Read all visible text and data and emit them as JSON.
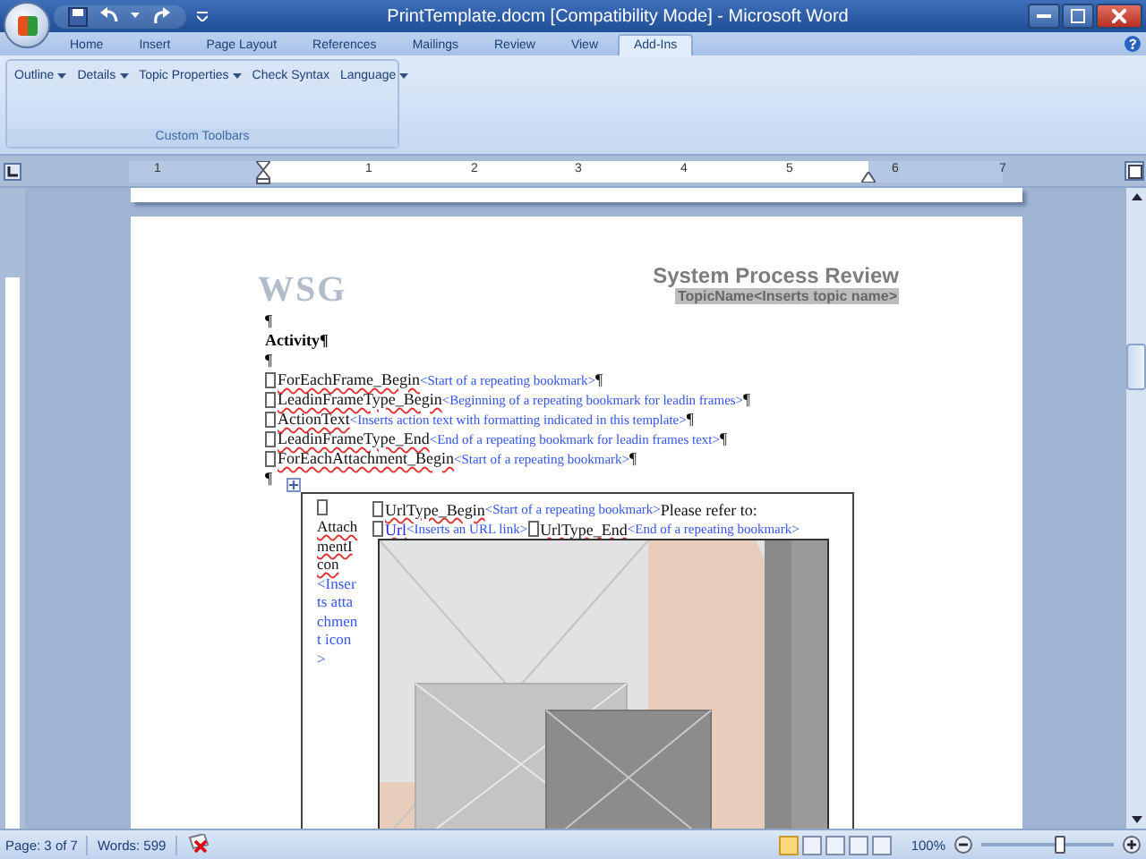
{
  "window": {
    "title": "PrintTemplate.docm [Compatibility Mode] - Microsoft Word"
  },
  "tabs": [
    {
      "label": "Home",
      "selected": false
    },
    {
      "label": "Insert",
      "selected": false
    },
    {
      "label": "Page Layout",
      "selected": false
    },
    {
      "label": "References",
      "selected": false
    },
    {
      "label": "Mailings",
      "selected": false
    },
    {
      "label": "Review",
      "selected": false
    },
    {
      "label": "View",
      "selected": false
    },
    {
      "label": "Add-Ins",
      "selected": true
    }
  ],
  "ribbon": {
    "group_label": "Custom Toolbars",
    "items": [
      {
        "label": "Outline",
        "dropdown": true
      },
      {
        "label": "Details",
        "dropdown": true
      },
      {
        "label": "Topic Properties",
        "dropdown": true
      },
      {
        "label": "Check Syntax",
        "dropdown": false
      },
      {
        "label": "Language",
        "dropdown": true
      }
    ]
  },
  "ruler": {
    "labels": [
      "1",
      "1",
      "2",
      "3",
      "4",
      "5",
      "6",
      "7"
    ]
  },
  "document": {
    "logo": "WSG",
    "heading": "System Process Review",
    "topic": "TopicName<Inserts topic name>",
    "lines": [
      {
        "kind": "mark",
        "text": "¶"
      },
      {
        "kind": "bold",
        "text": "Activity¶"
      },
      {
        "kind": "mark",
        "text": "¶"
      },
      {
        "kind": "bookmark",
        "name": "ForEachFrame_Begin",
        "hint": "<Start of a repeating bookmark>",
        "end": "¶"
      },
      {
        "kind": "bookmark",
        "name": "LeadinFrameType_Begin",
        "hint": "<Beginning of a repeating bookmark for leadin frames>",
        "end": "¶"
      },
      {
        "kind": "bookmark",
        "name": "ActionText",
        "hint": "<Inserts action text with formatting indicated in this template>",
        "end": "¶"
      },
      {
        "kind": "bookmark",
        "name": "LeadinFrameType_End",
        "hint": "<End of a repeating bookmark for leadin frames text>",
        "end": "¶"
      },
      {
        "kind": "bookmark",
        "name": "ForEachAttachment_Begin",
        "hint": "<Start of a repeating bookmark>",
        "end": "¶"
      },
      {
        "kind": "mark",
        "text": "¶"
      }
    ],
    "table": {
      "left_name": "AttachmentIcon",
      "left_hint": "<Inserts attachment icon>",
      "url_line": [
        {
          "name": "UrlType_Begin",
          "hint": "<Start of a repeating bookmark>"
        },
        {
          "text": "Please refer to:"
        }
      ],
      "link_line": [
        {
          "name": "Url",
          "hint": "<Inserts an URL link>"
        },
        {
          "name": "UrlType_End",
          "hint": "<End of a repeating bookmark>"
        }
      ]
    }
  },
  "status_bar": {
    "page": "Page: 3 of 7",
    "words": "Words: 599",
    "zoom": "100%",
    "zoom_slider": {
      "level": 0.6
    }
  }
}
